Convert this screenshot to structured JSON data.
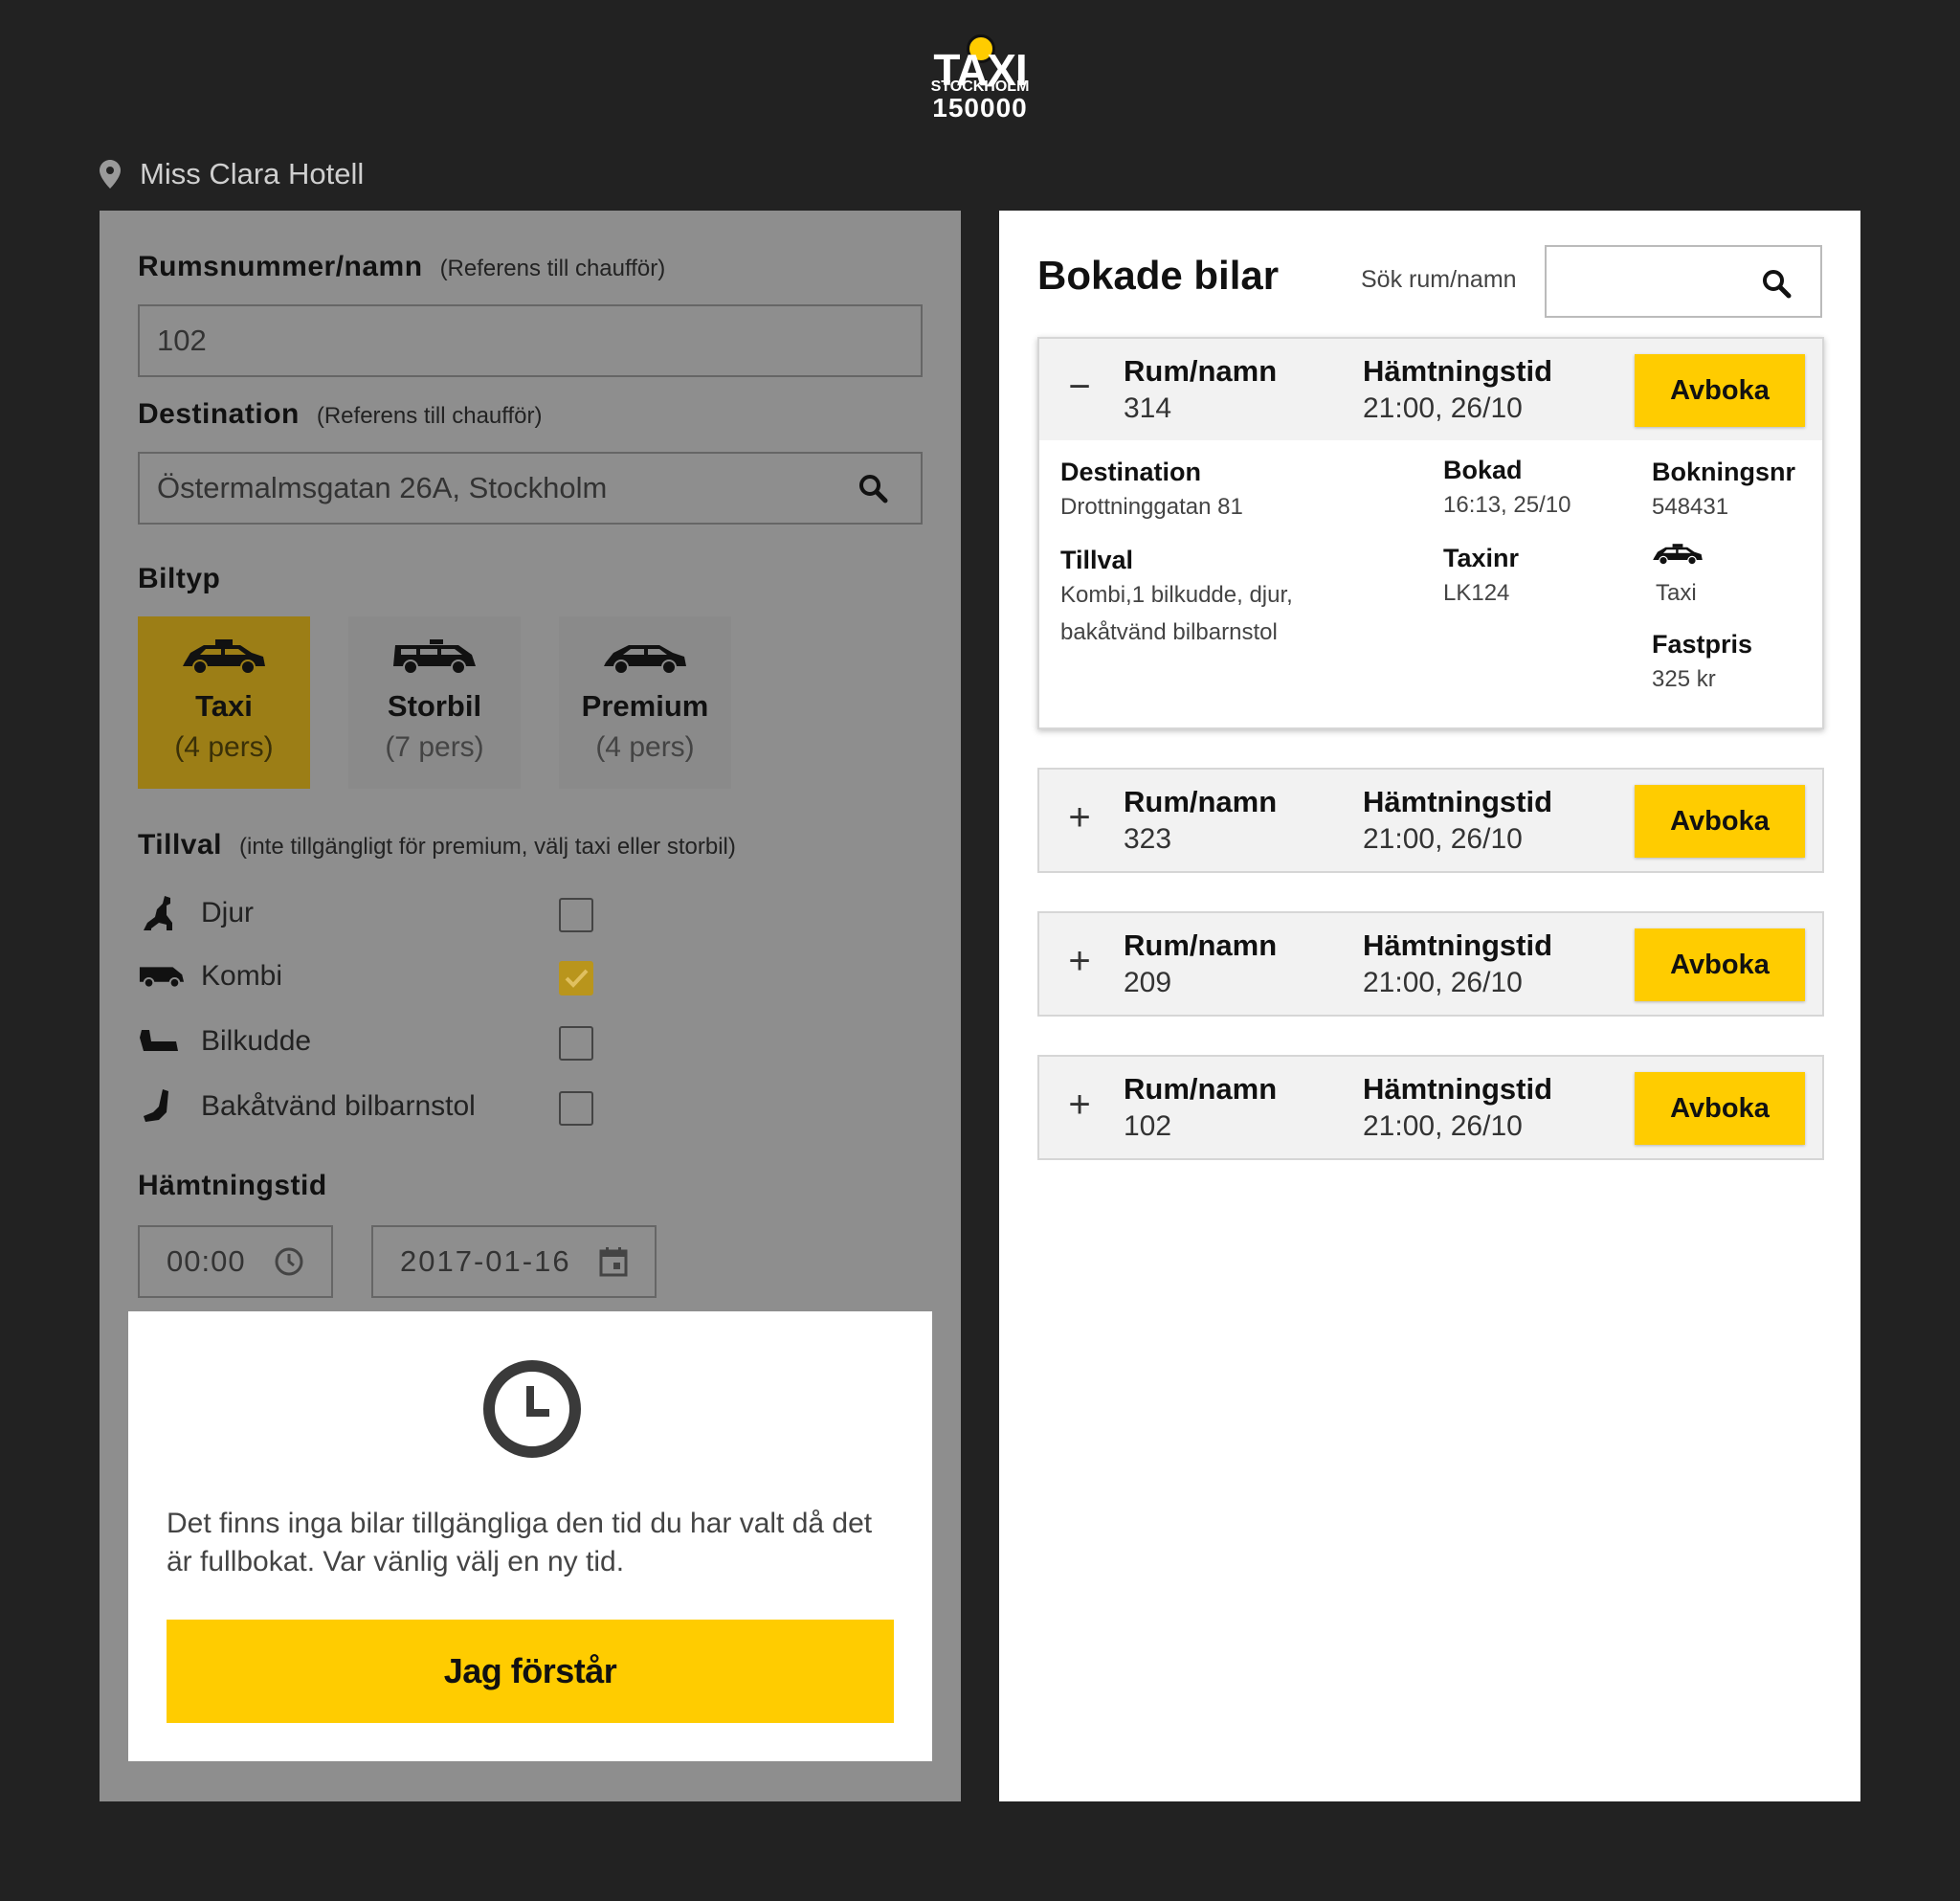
{
  "logo": {
    "line1": "TAXI",
    "line2": "STOCKHOLM",
    "line3": "150000"
  },
  "location": "Miss Clara Hotell",
  "form": {
    "room_label": "Rumsnummer/namn",
    "room_ref": "(Referens till chaufför)",
    "room_value": "102",
    "dest_label": "Destination",
    "dest_ref": "(Referens till chaufför)",
    "dest_value": "Östermalmsgatan 26A, Stockholm",
    "cartype_label": "Biltyp",
    "cars": [
      {
        "name": "Taxi",
        "pers": "(4 pers)",
        "selected": true
      },
      {
        "name": "Storbil",
        "pers": "(7 pers)",
        "selected": false
      },
      {
        "name": "Premium",
        "pers": "(4 pers)",
        "selected": false
      }
    ],
    "extras_label": "Tillval",
    "extras_note": "(inte tillgängligt för premium, välj taxi eller storbil)",
    "extras": [
      {
        "label": "Djur",
        "icon": "dog-icon",
        "checked": false
      },
      {
        "label": "Kombi",
        "icon": "van-icon",
        "checked": true
      },
      {
        "label": "Bilkudde",
        "icon": "booster-seat-icon",
        "checked": false
      },
      {
        "label": "Bakåtvänd bilbarnstol",
        "icon": "child-seat-icon",
        "checked": false
      }
    ],
    "pickup_label": "Hämtningstid",
    "time_value": "00:00",
    "date_value": "2017-01-16"
  },
  "modal": {
    "message": "Det finns inga bilar tillgängliga den tid du har valt då det är fullbokat. Var vänlig välj en ny tid.",
    "button": "Jag förstår"
  },
  "bookings_panel": {
    "title": "Bokade bilar",
    "search_label": "Sök rum/namn",
    "search_placeholder": "",
    "col_room": "Rum/namn",
    "col_time": "Hämtningstid",
    "cancel_label": "Avboka",
    "items": [
      {
        "toggle": "−",
        "room": "314",
        "time": "21:00, 26/10",
        "expanded": true,
        "details": {
          "dest_label": "Destination",
          "dest_value": "Drottninggatan 81",
          "booked_label": "Bokad",
          "booked_value": "16:13, 25/10",
          "bookingnr_label": "Bokningsnr",
          "bookingnr_value": "548431",
          "extras_label": "Tillval",
          "extras_value1": "Kombi,1 bilkudde, djur,",
          "extras_value2": "bakåtvänd bilbarnstol",
          "taxinr_label": "Taxinr",
          "taxinr_value": "LK124",
          "cartype_value": "Taxi",
          "price_label": "Fastpris",
          "price_value": "325 kr"
        }
      },
      {
        "toggle": "+",
        "room": "323",
        "time": "21:00, 26/10",
        "expanded": false
      },
      {
        "toggle": "+",
        "room": "209",
        "time": "21:00, 26/10",
        "expanded": false
      },
      {
        "toggle": "+",
        "room": "102",
        "time": "21:00, 26/10",
        "expanded": false
      }
    ]
  },
  "colors": {
    "background": "#222222",
    "accent": "#ffcc00",
    "overlay_panel": "#8e8e8e",
    "selected_car": "#9c7e16"
  }
}
